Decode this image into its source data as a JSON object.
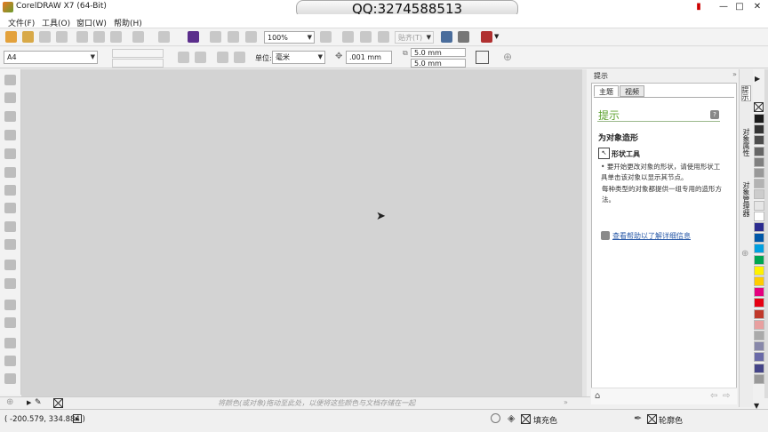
{
  "window": {
    "title": "CorelDRAW X7 (64-Bit)",
    "overlay": "QQ:3274588513"
  },
  "menu": [
    "文件(F)",
    "工具(O)",
    "窗口(W)",
    "帮助(H)"
  ],
  "toolbar": {
    "zoom": "100%",
    "snap": "贴齐(T)"
  },
  "propbar": {
    "page_size": "A4",
    "units_label": "单位:",
    "units": "毫米",
    "nudge": ".001 mm",
    "dup_x": "5.0 mm",
    "dup_y": "5.0 mm"
  },
  "canvas": {
    "drop_hint": "将颜色(或对象)拖动至此处，以便将这些颜色与文档存储在一起"
  },
  "docker": {
    "header": "提示",
    "tabs": [
      "主题",
      "视频"
    ],
    "hint_title": "提示",
    "section_title": "为对象造形",
    "tool_name": "形状工具",
    "para1": "要开始更改对象的形状，请使用形状工具单击该对象以显示其节点。",
    "para2": "每种类型的对象都提供一组专用的造形方法。",
    "help_link": "查看帮助以了解详细信息",
    "vertical_tabs": [
      "提示",
      "对象属性",
      "对象管理器"
    ]
  },
  "palette": {
    "colors": [
      "#1a1a1a",
      "#333333",
      "#4d4d4d",
      "#666666",
      "#808080",
      "#999999",
      "#b3b3b3",
      "#cccccc",
      "#e6e6e6",
      "#ffffff",
      "#2b2b8f",
      "#0058a8",
      "#00a0e0",
      "#00a651",
      "#fff200",
      "#ffcc00",
      "#e4007f",
      "#e60012",
      "#c0392b",
      "#e8a0a0",
      "#aaaaaa",
      "#8888aa",
      "#6a6aa8",
      "#444488",
      "#999999"
    ]
  },
  "status": {
    "coords": "( -200.579, 334.884 )",
    "fill": "填充色",
    "outline": "轮廓色"
  }
}
